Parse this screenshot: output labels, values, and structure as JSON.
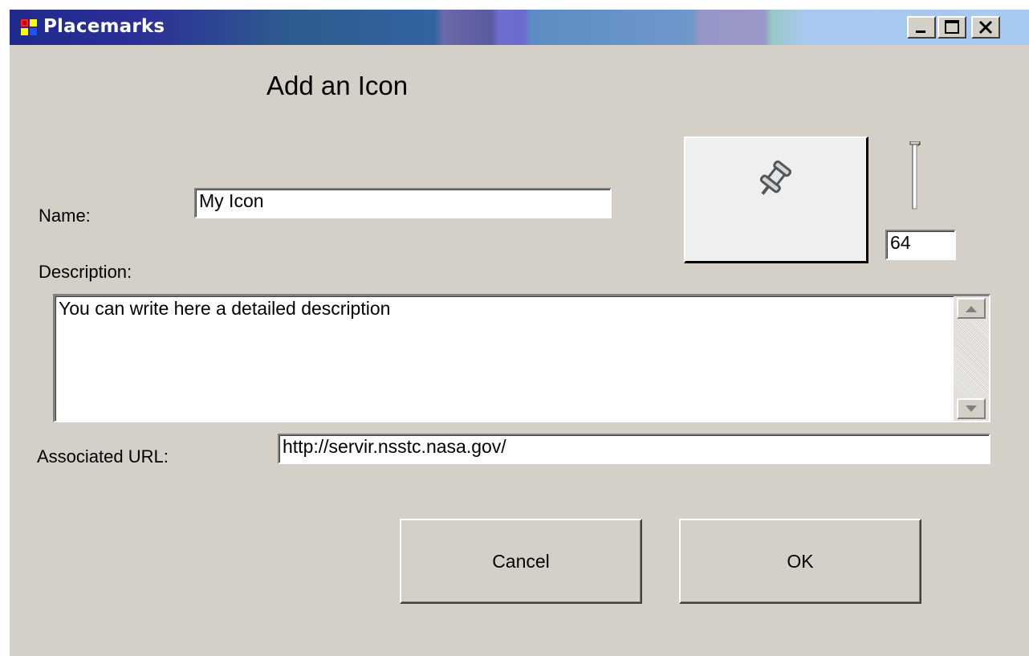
{
  "window": {
    "title": "Placemarks",
    "app_icon": "app-window-icon",
    "controls": [
      "minimize-icon",
      "maximize-icon",
      "close-icon"
    ]
  },
  "dialog": {
    "heading": "Add an Icon",
    "name_label": "Name:",
    "name_value": "My Icon",
    "description_label": "Description:",
    "description_value": "You can write here a detailed description",
    "url_label": "Associated URL:",
    "url_value": "http://servir.nsstc.nasa.gov/",
    "icon_preview": "pushpin-icon",
    "size_value": "64",
    "cancel_label": "Cancel",
    "ok_label": "OK"
  },
  "colors": {
    "window_bg": "#d4d0c8",
    "title_text": "#ffffff"
  }
}
